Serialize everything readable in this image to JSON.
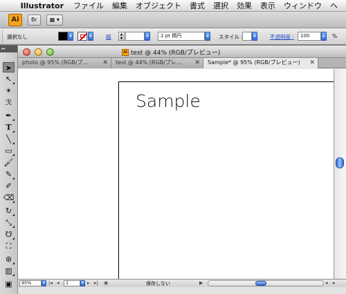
{
  "menubar": {
    "app_name": "Illustrator",
    "items": [
      "ファイル",
      "編集",
      "オブジェクト",
      "書式",
      "選択",
      "効果",
      "表示",
      "ウィンドウ",
      "ヘ"
    ]
  },
  "appbar": {
    "logo": "Ai",
    "bridge_label": "Br"
  },
  "control": {
    "selection_status": "選択なし",
    "stroke_label": "線",
    "stroke_weight": "2 pt 楕円",
    "style_label": "スタイル :",
    "opacity_label": "不透明度 :",
    "opacity_value": "100",
    "opacity_unit": "%",
    "fill_color": "#000000",
    "stroke_color": "none"
  },
  "window": {
    "title": "test @ 44% (RGB/プレビュー)",
    "tabs": [
      {
        "label": "photo @ 95% (RGB/プ…",
        "close": "✕"
      },
      {
        "label": "test @ 44% (RGB/プレ…",
        "close": "✕"
      },
      {
        "label": "Sample* @ 95% (RGB/プレビュー)",
        "close": "✕"
      }
    ],
    "active_tab": 2
  },
  "canvas": {
    "text": "Sample"
  },
  "statusbar": {
    "zoom": "95%",
    "artboard_number": "1",
    "status_text": "保存しない"
  },
  "colors": {
    "accent_blue": "#2e68d0",
    "ai_orange": "#f7a21b",
    "link_blue": "#2350c8"
  }
}
